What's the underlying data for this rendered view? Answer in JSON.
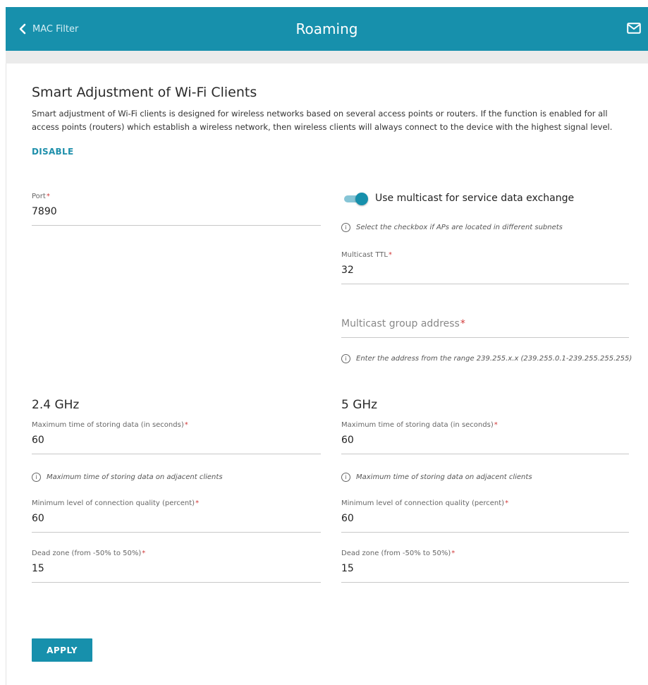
{
  "header": {
    "back_label": "MAC Filter",
    "title": "Roaming",
    "accent": "#1790ac"
  },
  "section": {
    "title": "Smart Adjustment of Wi-Fi Clients",
    "description_line1": "Smart adjustment of Wi-Fi clients is designed for wireless networks based on several access points or routers. If the function is enabled for all",
    "description_line2": "access points (routers) which establish a wireless network, then wireless clients will always connect to the device with the highest signal level.",
    "disable_label": "DISABLE"
  },
  "general": {
    "port_label": "Port",
    "port_value": "7890",
    "multicast_toggle_label": "Use multicast for service data exchange",
    "multicast_enabled": true,
    "multicast_hint": "Select the checkbox if APs are located in different subnets",
    "ttl_label": "Multicast TTL",
    "ttl_value": "32",
    "group_address_placeholder": "Multicast group address",
    "group_address_hint": "Enter the address from the range 239.255.x.x (239.255.0.1-239.255.255.255)"
  },
  "band24": {
    "title": "2.4 GHz",
    "max_time_label": "Maximum time of storing data (in seconds)",
    "max_time_value": "60",
    "max_time_hint": "Maximum time of storing data on adjacent clients",
    "min_quality_label": "Minimum level of connection quality (percent)",
    "min_quality_value": "60",
    "dead_zone_label": "Dead zone (from -50% to 50%)",
    "dead_zone_value": "15"
  },
  "band5": {
    "title": "5 GHz",
    "max_time_label": "Maximum time of storing data (in seconds)",
    "max_time_value": "60",
    "max_time_hint": "Maximum time of storing data on adjacent clients",
    "min_quality_label": "Minimum level of connection quality (percent)",
    "min_quality_value": "60",
    "dead_zone_label": "Dead zone (from -50% to 50%)",
    "dead_zone_value": "15"
  },
  "actions": {
    "apply_label": "APPLY"
  },
  "icons": {
    "back": "chevron-left-icon",
    "mail": "mail-icon",
    "info": "info-icon"
  }
}
